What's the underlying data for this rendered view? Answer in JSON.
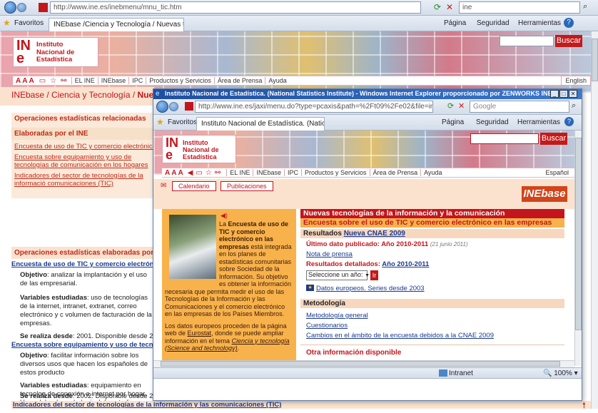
{
  "outer": {
    "address": "http://www.ine.es/inebmenu/mnu_tic.htm",
    "search_text": "ine",
    "favorites_label": "Favoritos",
    "tab_label": "INEbase /Ciencia y Tecnología / Nuevas tecnologías d...",
    "toolbar": {
      "pagina": "Página",
      "seguridad": "Seguridad",
      "herramientas": "Herramientas"
    },
    "logo": {
      "mark": "IN e",
      "line1": "Instituto",
      "line2": "Nacional de",
      "line3": "Estadística"
    },
    "buscar": "Buscar",
    "font_sizes": "A A A",
    "nav": [
      "EL INE",
      "INEbase",
      "IPC",
      "Productos y Servicios",
      "Área de Prensa",
      "Ayuda"
    ],
    "english": "English",
    "breadcrumb_prefix": "INEbase / Ciencia y Tecnología / ",
    "breadcrumb_bold": "Nuevas te",
    "side": {
      "heading1": "Operaciones estadísticas relacionadas",
      "heading2": "Elaboradas por el INE",
      "links": [
        "Encuesta de uso de TIC y comercio electrónico en las",
        "Encuesta sobre equipamiento y uso de tecnologías de comunicación en los hogares",
        "Indicadores del sector de tecnologías de la informació comunicaciones (TIC)"
      ]
    },
    "lower": {
      "heading": "Operaciones estadísticas elaboradas por el INE",
      "item1_title": "Encuesta de uso de TIC y comercio electrónico",
      "objetivo_label": "Objetivo",
      "item1_objetivo": ": analizar la implantación y el uso de las empresarial.",
      "variables_label": "Variables estudiadas",
      "item1_variables": ": uso de tecnologías de la internet, intranet, extranet, correo electrónico y c volumen de facturación de la empresas.",
      "realiza_label": "Se realiza desde",
      "item1_realiza": ": 2001. Disponible desde 2001",
      "item2_title": "Encuesta sobre equipamiento y uso de tecnolog",
      "item2_objetivo": ": facilitar información sobre los diversos usos que hacen los españoles de estos producto",
      "item2_variables": ": equipamiento en tecnolog de conexión a internet por hogar. Usos del orden edad, nivel de estudios y situación laboral.",
      "item2_realiza": ": 2002. Disponible desde 2002",
      "item3_title": "Indicadores del sector de tecnologías de la información y las comunicaciones (TIC)"
    }
  },
  "popup": {
    "title": "Instituto Nacional de Estadística. (National Statistics Institute) - Windows Internet Explorer proporcionado por ZENWORKS INE",
    "address": "http://www.ine.es/jaxi/menu.do?type=pcaxis&path=%2Ft09%2Fe02&file=inebase&L=0",
    "search_text": "Google",
    "favorites_label": "Favoritos",
    "tab_label": "Instituto Nacional de Estadística. (National Statistics I...",
    "toolbar": {
      "pagina": "Página",
      "seguridad": "Seguridad",
      "herramientas": "Herramientas"
    },
    "logo": {
      "mark": "IN e",
      "line1": "Instituto",
      "line2": "Nacional de",
      "line3": "Estadística"
    },
    "buscar": "Buscar",
    "nav": [
      "EL INE",
      "INEbase",
      "IPC",
      "Productos y Servicios",
      "Área de Prensa",
      "Ayuda"
    ],
    "espanol": "Español",
    "subtabs": [
      "Calendario",
      "Publicaciones"
    ],
    "inebase_logo": "INEbase",
    "left_box": {
      "intro": "La ",
      "bold": "Encuesta de uso de TIC y comercio electrónico en las empresas",
      "text1": " está integrada en los planes de estadísticas comunitarias sobre Sociedad de la Información. Su objetivo es obtener la información necesaria que permita medir el uso de las Tecnologías de la Información y las Comunicaciones y el comercio electrónico en las empresas de los Países Miembros.",
      "text2": "Los datos europeos proceden de la página web de ",
      "eurostat": "Eurostat",
      "text3": ", donde se puede ampliar información en el tema ",
      "tema": "Ciencia y tecnología (Science and technology)",
      "end": "."
    },
    "main": {
      "title1": "Nuevas tecnologías de la información y la comunicación",
      "title2": "Encuesta sobre el uso de TIC y comercio electrónico en las empresas",
      "resultados_label": "Resultados",
      "cnae": "Nueva CNAE 2009",
      "ultimo_label": "Último dato publicado: Año 2010-2011",
      "ultimo_date": "(21 junio 2011)",
      "nota": "Nota de prensa",
      "detallados_label": "Resultados detallados: ",
      "detallados_link": "Año 2010-2011",
      "select": "Seleccione un año:",
      "ir": "Ir",
      "datos_europeos": "Datos europeos. Series desde 2003",
      "metodologia": "Metodología",
      "met_links": [
        "Metodología general",
        "Cuestionarios",
        "Cambios en el ámbito de la encuesta debidos a la CNAE 2009"
      ],
      "otra": "Otra información disponible"
    },
    "status": {
      "zone": "Intranet",
      "zoom": "100%"
    }
  }
}
